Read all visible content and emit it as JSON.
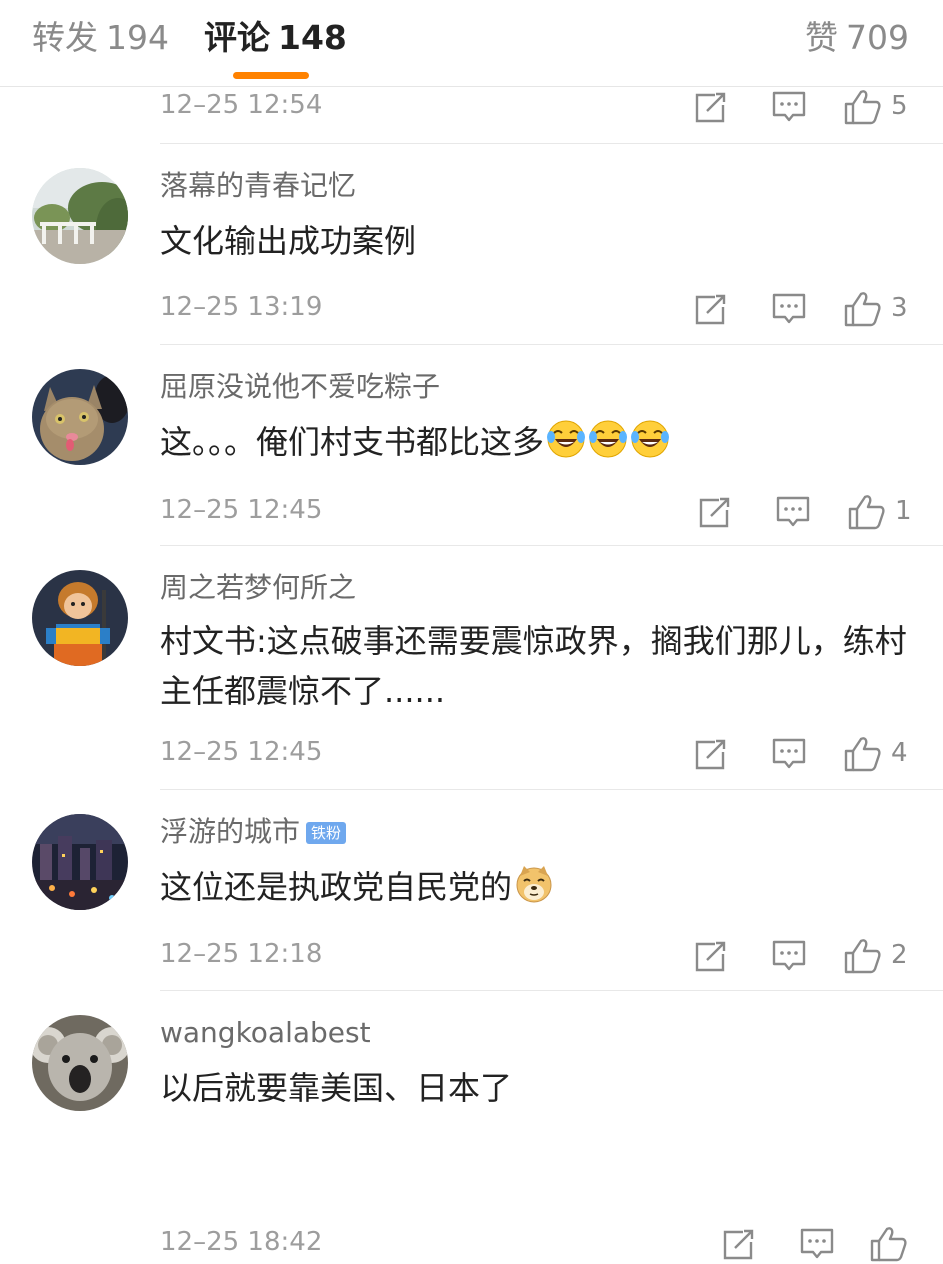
{
  "tabs": {
    "repost": {
      "label": "转发",
      "count": "194"
    },
    "comment": {
      "label": "评论",
      "count": "148"
    },
    "like": {
      "label": "赞",
      "count": "709"
    }
  },
  "top_partial": {
    "time": "12–25 12:54",
    "likes": "5"
  },
  "comments": [
    {
      "username": "落幕的青春记忆",
      "text": "文化输出成功案例",
      "time": "12–25 13:19",
      "likes": "3",
      "avatar": "garden-path-avatar"
    },
    {
      "username": "屈原没说他不爱吃粽子",
      "text": "这。。。俺们村支书都比这多",
      "emojis": [
        "laugh-cry-emoji",
        "laugh-cry-emoji",
        "laugh-cry-emoji"
      ],
      "time": "12–25 12:45",
      "likes": "1",
      "avatar": "cat-avatar"
    },
    {
      "username": "周之若梦何所之",
      "text": "村文书:这点破事还需要震惊政界，搁我们那儿，练村主任都震惊不了......",
      "time": "12–25 12:45",
      "likes": "4",
      "avatar": "cartoon-monkey-king-avatar"
    },
    {
      "username": "浮游的城市",
      "badge": "铁粉",
      "text": "这位还是执政党自民党的",
      "emojis": [
        "doge-emoji"
      ],
      "time": "12–25 12:18",
      "likes": "2",
      "avatar": "night-city-avatar"
    },
    {
      "username": "wangkoalabest",
      "text": "以后就要靠美国、日本了",
      "time": "12–25 18:42",
      "likes": "",
      "avatar": "koala-avatar"
    }
  ],
  "colors": {
    "accent": "#ff8200",
    "badge": "#6fa8ee",
    "muted": "#9d9d9d"
  }
}
